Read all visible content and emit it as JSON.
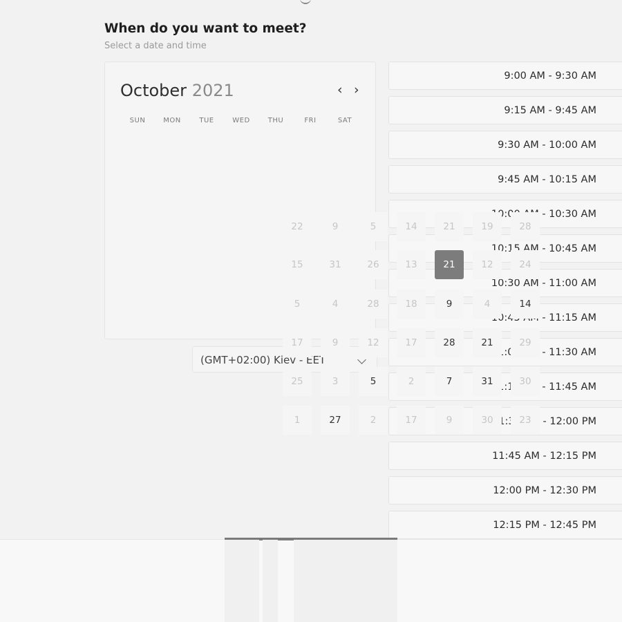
{
  "header": {
    "title": "When do you want to meet?",
    "subtitle": "Select a date and time"
  },
  "calendar": {
    "month": "October",
    "year": "2021",
    "prev_icon": "chevron-left-icon",
    "next_icon": "chevron-right-icon",
    "weekdays": [
      "SUN",
      "MON",
      "TUE",
      "WED",
      "THU",
      "FRI",
      "SAT"
    ],
    "days": [
      {
        "label": "22",
        "state": "disabled"
      },
      {
        "label": "9",
        "state": "disabled"
      },
      {
        "label": "5",
        "state": "disabled"
      },
      {
        "label": "14",
        "state": "disabled"
      },
      {
        "label": "21",
        "state": "disabled"
      },
      {
        "label": "19",
        "state": "disabled"
      },
      {
        "label": "28",
        "state": "disabled"
      },
      {
        "label": "15",
        "state": "disabled"
      },
      {
        "label": "31",
        "state": "disabled"
      },
      {
        "label": "26",
        "state": "disabled"
      },
      {
        "label": "13",
        "state": "disabled"
      },
      {
        "label": "21",
        "state": "selected"
      },
      {
        "label": "12",
        "state": "disabled"
      },
      {
        "label": "24",
        "state": "disabled"
      },
      {
        "label": "5",
        "state": "disabled"
      },
      {
        "label": "4",
        "state": "disabled"
      },
      {
        "label": "28",
        "state": "disabled"
      },
      {
        "label": "18",
        "state": "disabled"
      },
      {
        "label": "9",
        "state": "available"
      },
      {
        "label": "4",
        "state": "disabled"
      },
      {
        "label": "14",
        "state": "available"
      },
      {
        "label": "17",
        "state": "disabled"
      },
      {
        "label": "9",
        "state": "disabled"
      },
      {
        "label": "12",
        "state": "disabled"
      },
      {
        "label": "17",
        "state": "disabled"
      },
      {
        "label": "28",
        "state": "available"
      },
      {
        "label": "21",
        "state": "available"
      },
      {
        "label": "29",
        "state": "disabled"
      },
      {
        "label": "25",
        "state": "disabled"
      },
      {
        "label": "3",
        "state": "disabled"
      },
      {
        "label": "5",
        "state": "available"
      },
      {
        "label": "2",
        "state": "disabled"
      },
      {
        "label": "7",
        "state": "available"
      },
      {
        "label": "31",
        "state": "available"
      },
      {
        "label": "30",
        "state": "disabled"
      },
      {
        "label": "1",
        "state": "disabled"
      },
      {
        "label": "27",
        "state": "available"
      },
      {
        "label": "2",
        "state": "disabled"
      },
      {
        "label": "17",
        "state": "disabled"
      },
      {
        "label": "9",
        "state": "disabled"
      },
      {
        "label": "30",
        "state": "disabled"
      },
      {
        "label": "23",
        "state": "disabled"
      }
    ]
  },
  "timezone": {
    "label": "(GMT+02:00) Kiev - EET",
    "icon": "chevron-down-icon"
  },
  "time_slots": [
    "9:00 AM - 9:30 AM",
    "9:15 AM - 9:45 AM",
    "9:30 AM - 10:00 AM",
    "9:45 AM - 10:15 AM",
    "10:00 AM - 10:30 AM",
    "10:15 AM - 10:45 AM",
    "10:30 AM - 11:00 AM",
    "10:45 AM - 11:15 AM",
    "11:00 AM - 11:30 AM",
    "11:15 AM - 11:45 AM",
    "11:30 AM - 12:00 PM",
    "11:45 AM - 12:15 PM",
    "12:00 PM - 12:30 PM",
    "12:15 PM - 12:45 PM"
  ],
  "colors": {
    "selected_day": "#7c7c7c",
    "scroll_indicator": "#7a7a7a"
  }
}
